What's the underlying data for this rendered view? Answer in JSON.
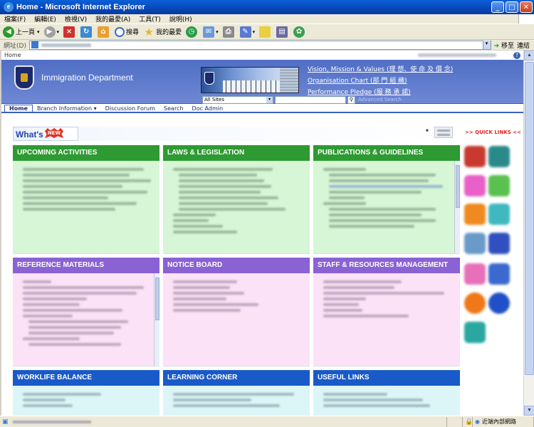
{
  "window": {
    "title": "Home - Microsoft Internet Explorer",
    "ie_icon": "e"
  },
  "menu": [
    "檔案(F)",
    "編輯(E)",
    "檢視(V)",
    "我的最愛(A)",
    "工具(T)",
    "說明(H)"
  ],
  "toolbar": {
    "back_label": "上一頁",
    "search_label": "搜尋",
    "favorites_label": "我的最愛"
  },
  "address": {
    "label": "網址(D)",
    "go_label": "移至",
    "links_label": "連結"
  },
  "sharepoint": {
    "top_label": "Home",
    "help_glyph": "?"
  },
  "banner": {
    "department": "Immigration Department",
    "links": [
      "Vision, Mission & Values (理 想、使 命 及 價 念)",
      "Organisation Chart (部 門 組 織)",
      "Performance Pledge (服 務 承 諾)"
    ],
    "search_scope": "All Sites",
    "advanced_search": "Advanced Search"
  },
  "nav": [
    "Home",
    "Branch Information ▾",
    "Discussion Forum",
    "Search",
    "Doc Admin"
  ],
  "whats_new": {
    "title": "What's",
    "badge": "NEW"
  },
  "quick_links": {
    "title": ">> QUICK LINKS <<",
    "icons": [
      {
        "name": "phone-red-icon",
        "color": "#c83a30"
      },
      {
        "name": "phone-teal-icon",
        "color": "#2a8a8a"
      },
      {
        "name": "magenta-tile-icon",
        "color": "#e860c8"
      },
      {
        "name": "green-tile-icon",
        "color": "#5ac050"
      },
      {
        "name": "orange-tile-icon",
        "color": "#f08a20"
      },
      {
        "name": "teal-tile-icon",
        "color": "#40b8c0"
      },
      {
        "name": "photo-tile-icon",
        "color": "#6a9ac8"
      },
      {
        "name": "blue-tile-icon",
        "color": "#3050c0"
      },
      {
        "name": "pink-tile-icon",
        "color": "#e870b8"
      },
      {
        "name": "notice-tile-icon",
        "color": "#3a6ad0"
      },
      {
        "name": "orange-circle-icon",
        "color": "#f07818"
      },
      {
        "name": "blue-circle-icon",
        "color": "#2050c8"
      },
      {
        "name": "teal-circle-icon",
        "color": "#2aa8a0"
      }
    ]
  },
  "panels": [
    {
      "title": "UPCOMING ACTIVITIES",
      "color": "green"
    },
    {
      "title": "LAWS & LEGISLATION",
      "color": "green"
    },
    {
      "title": "PUBLICATIONS & GUIDELINES",
      "color": "green"
    },
    {
      "title": "REFERENCE MATERIALS",
      "color": "purple"
    },
    {
      "title": "NOTICE BOARD",
      "color": "purple"
    },
    {
      "title": "STAFF & RESOURCES MANAGEMENT",
      "color": "purple"
    },
    {
      "title": "WORKLIFE BALANCE",
      "color": "blue"
    },
    {
      "title": "LEARNING CORNER",
      "color": "blue"
    },
    {
      "title": "USEFUL LINKS",
      "color": "blue"
    }
  ],
  "status": {
    "zone": "近端內部網路"
  }
}
